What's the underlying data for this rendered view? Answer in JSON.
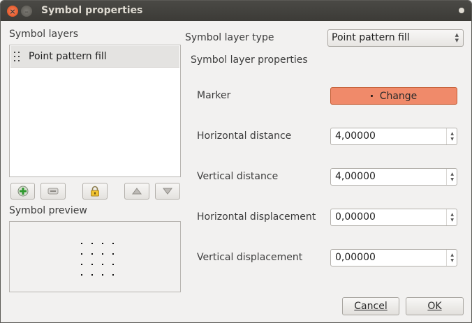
{
  "window": {
    "title": "Symbol properties"
  },
  "left": {
    "layers_heading": "Symbol layers",
    "layers": [
      {
        "label": "Point pattern fill",
        "icon": "point-pattern-icon"
      }
    ],
    "toolbar": {
      "add_icon": "plus-green-icon",
      "remove_icon": "minus-icon",
      "lock_icon": "lock-icon",
      "up_icon": "triangle-up-icon",
      "down_icon": "triangle-down-icon"
    },
    "preview_heading": "Symbol preview"
  },
  "right": {
    "layer_type_label": "Symbol layer type",
    "layer_type_value": "Point pattern fill",
    "properties_heading": "Symbol layer properties",
    "marker_label": "Marker",
    "marker_button": "Change",
    "marker_button_color": "#f08a6a",
    "fields": [
      {
        "label": "Horizontal distance",
        "value": "4,00000"
      },
      {
        "label": "Vertical distance",
        "value": "4,00000"
      },
      {
        "label": "Horizontal displacement",
        "value": "0,00000"
      },
      {
        "label": "Vertical displacement",
        "value": "0,00000"
      }
    ]
  },
  "buttons": {
    "cancel": "Cancel",
    "ok": "OK"
  }
}
